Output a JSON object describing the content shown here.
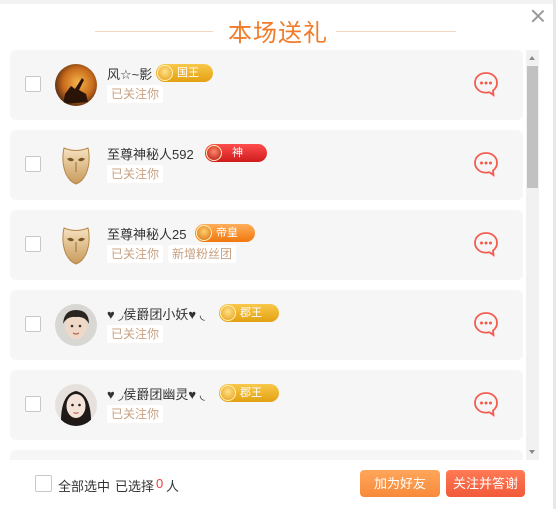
{
  "dialog": {
    "title": "本场送礼"
  },
  "users": [
    {
      "name": "风☆~影",
      "badge": {
        "label": "国王",
        "kind": "king"
      },
      "tags": [
        "已关注你"
      ]
    },
    {
      "name": "至尊神秘人592",
      "badge": {
        "label": "神",
        "kind": "god"
      },
      "tags": [
        "已关注你"
      ]
    },
    {
      "name": "至尊神秘人25",
      "badge": {
        "label": "帝皇",
        "kind": "emperor"
      },
      "tags": [
        "已关注你",
        "新增粉丝团"
      ]
    },
    {
      "name": "♥ ◞侯爵团小妖♥ ◟",
      "badge": {
        "label": "郡王",
        "kind": "prince"
      },
      "tags": [
        "已关注你"
      ]
    },
    {
      "name": "♥ ◞侯爵团幽灵♥ ◟",
      "badge": {
        "label": "郡王",
        "kind": "prince"
      },
      "tags": [
        "已关注你"
      ]
    }
  ],
  "footer": {
    "select_all_label": "全部选中",
    "selected_prefix": "已选择",
    "selected_count": "0",
    "selected_unit": "人",
    "add_friend_label": "加为好友",
    "follow_thank_label": "关注并答谢"
  },
  "colors": {
    "accent": "#f07b2a",
    "chat_icon": "#f35b4f",
    "count": "#f23c3c"
  },
  "icons": {
    "close": "close-icon",
    "chat": "chat-bubble-icon",
    "scroll_up": "chevron-up-icon",
    "scroll_down": "chevron-down-icon"
  }
}
